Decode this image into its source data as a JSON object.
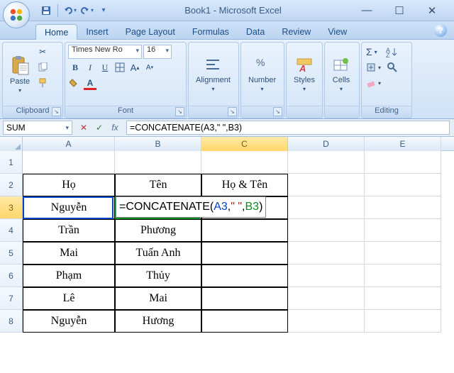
{
  "title": "Book1 - Microsoft Excel",
  "qat": {
    "save": "save-icon",
    "undo": "undo-icon",
    "redo": "redo-icon"
  },
  "tabs": [
    "Home",
    "Insert",
    "Page Layout",
    "Formulas",
    "Data",
    "Review",
    "View"
  ],
  "active_tab": 0,
  "ribbon": {
    "clipboard": {
      "label": "Clipboard",
      "paste": "Paste"
    },
    "font": {
      "label": "Font",
      "name": "Times New Ro",
      "size": "16",
      "bold": "B",
      "italic": "I",
      "underline": "U"
    },
    "alignment": {
      "label": "Alignment"
    },
    "number": {
      "label": "Number"
    },
    "styles": {
      "label": "Styles"
    },
    "cells": {
      "label": "Cells"
    },
    "editing": {
      "label": "Editing"
    }
  },
  "namebox": "SUM",
  "formula_input": "=CONCATENATE(A3,\" \",B3)",
  "columns": [
    "A",
    "B",
    "C",
    "D",
    "E"
  ],
  "row_numbers": [
    "1",
    "2",
    "3",
    "4",
    "5",
    "6",
    "7",
    "8"
  ],
  "cells": {
    "r2": {
      "A": "Họ",
      "B": "Tên",
      "C": "Họ & Tên"
    },
    "r3": {
      "A": "Nguyễn"
    },
    "edit_overlay": {
      "prefix": "=CONCATENATE(",
      "arg1": "A3",
      "sep1": ",",
      "lit": "\" \"",
      "sep2": ",",
      "arg2": "B3",
      "suffix": ")"
    },
    "r4": {
      "A": "Trần",
      "B": "Phương"
    },
    "r5": {
      "A": "Mai",
      "B": "Tuấn Anh"
    },
    "r6": {
      "A": "Phạm",
      "B": "Thủy"
    },
    "r7": {
      "A": "Lê",
      "B": "Mai"
    },
    "r8": {
      "A": "Nguyễn",
      "B": "Hương"
    }
  },
  "chart_data": {
    "type": "table",
    "title": "Họ & Tên",
    "columns": [
      "Họ",
      "Tên",
      "Họ & Tên"
    ],
    "rows": [
      [
        "Nguyễn",
        "",
        "=CONCATENATE(A3,\" \",B3)"
      ],
      [
        "Trần",
        "Phương",
        ""
      ],
      [
        "Mai",
        "Tuấn Anh",
        ""
      ],
      [
        "Phạm",
        "Thủy",
        ""
      ],
      [
        "Lê",
        "Mai",
        ""
      ],
      [
        "Nguyễn",
        "Hương",
        ""
      ]
    ]
  }
}
